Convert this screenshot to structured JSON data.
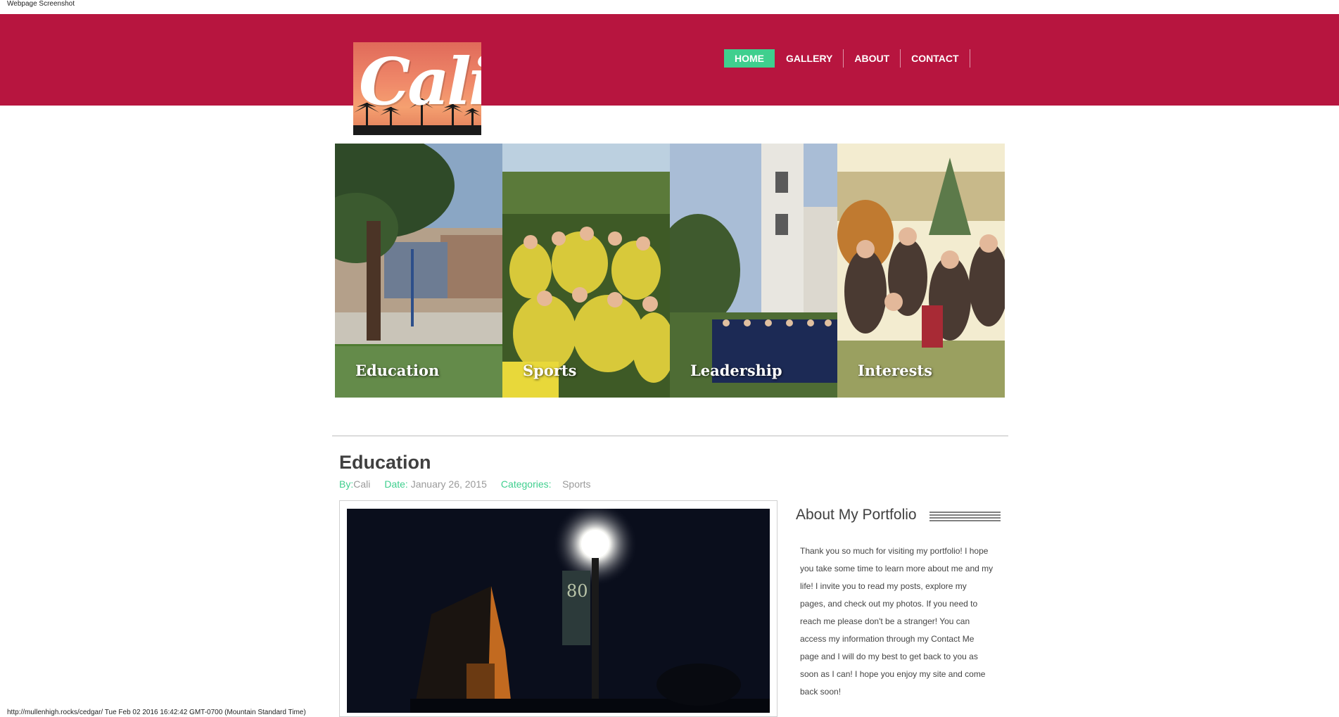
{
  "screenshot_caption": "Webpage Screenshot",
  "footer_url": "http://mullenhigh.rocks/cedgar/ Tue Feb 02 2016 16:42:42 GMT-0700 (Mountain Standard Time)",
  "colors": {
    "header": "#b7153f",
    "accent": "#3fcf8e"
  },
  "logo": {
    "text": "Cali"
  },
  "nav": [
    {
      "label": "HOME",
      "active": true
    },
    {
      "label": "GALLERY"
    },
    {
      "label": "ABOUT"
    },
    {
      "label": "CONTACT"
    }
  ],
  "tiles": [
    {
      "label": "Education"
    },
    {
      "label": "Sports"
    },
    {
      "label": "Leadership"
    },
    {
      "label": "Interests"
    }
  ],
  "post": {
    "title": "Education",
    "by_label": "By:",
    "author": "Cali",
    "date_label": "Date:",
    "date": "January 26, 2015",
    "categories_label": "Categories:",
    "category": "Sports",
    "banner_text": "80"
  },
  "sidebar": {
    "title": "About My Portfolio",
    "text": "Thank you so much for visiting my portfolio! I hope you take some time to learn more about me and my life! I invite you to read my posts, explore my pages, and check out my photos. If you need to reach me please don't be a stranger! You can access my information through my Contact Me page and I will do my best to get back to you as soon as I can! I hope you enjoy my site and come back soon!"
  }
}
